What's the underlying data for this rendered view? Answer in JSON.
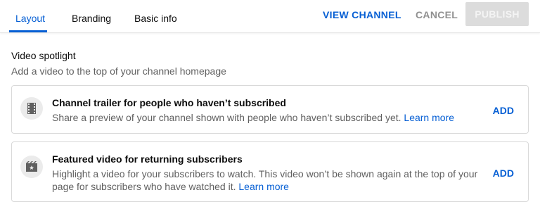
{
  "tabs": [
    {
      "label": "Layout",
      "active": true
    },
    {
      "label": "Branding",
      "active": false
    },
    {
      "label": "Basic info",
      "active": false
    }
  ],
  "actions": {
    "view_channel": "VIEW CHANNEL",
    "cancel": "CANCEL",
    "publish": "PUBLISH"
  },
  "video_spotlight": {
    "title": "Video spotlight",
    "subtitle": "Add a video to the top of your channel homepage",
    "cards": [
      {
        "icon": "film-strip-icon",
        "title": "Channel trailer for people who haven’t subscribed",
        "description": "Share a preview of your channel shown with people who haven’t subscribed yet.",
        "learn_more": "Learn more",
        "add_label": "ADD"
      },
      {
        "icon": "featured-video-icon",
        "title": "Featured video for returning subscribers",
        "description": "Highlight a video for your subscribers to watch. This video won’t be shown again at the top of your page for subscribers who have watched it.",
        "learn_more": "Learn more",
        "add_label": "ADD"
      }
    ]
  },
  "colors": {
    "accent": "#065fd4",
    "muted_text": "#606060",
    "disabled": "#909090",
    "publish_bg": "#dcdcdc"
  }
}
